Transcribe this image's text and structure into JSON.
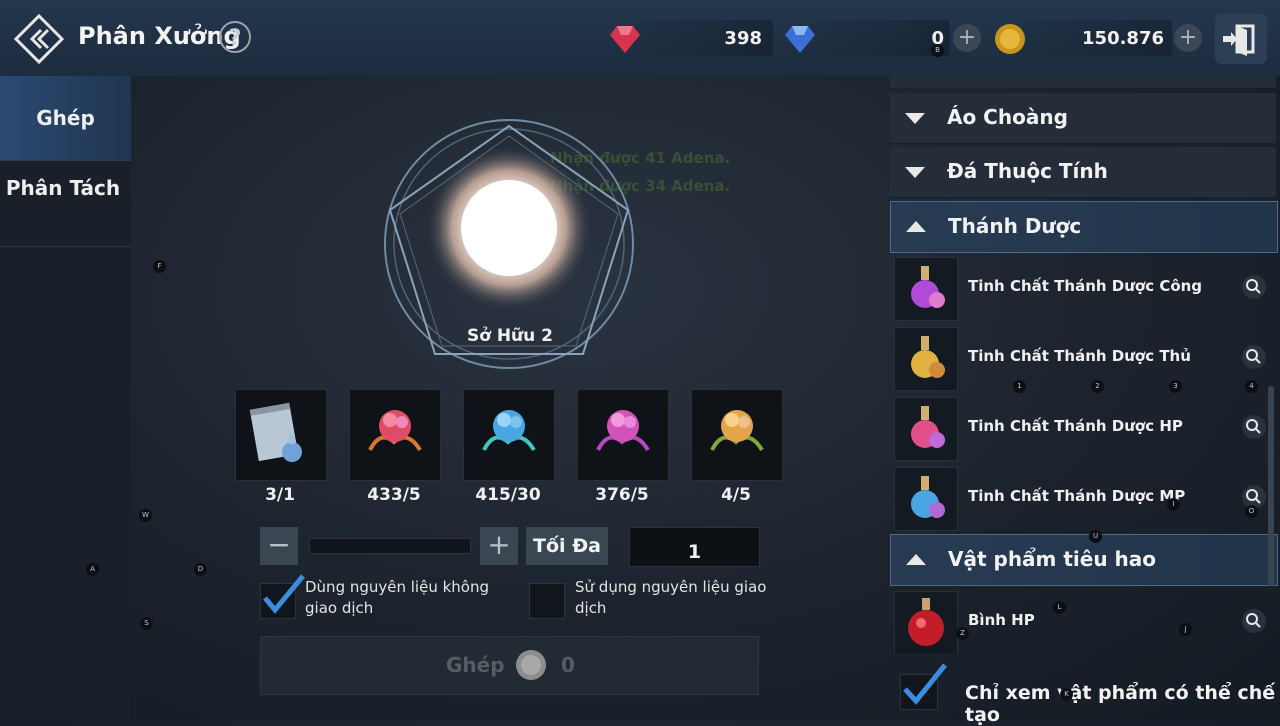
{
  "header": {
    "title": "Phân Xưởng",
    "help_label": "?",
    "currencies": [
      {
        "icon": "red-gem-icon",
        "value": "398",
        "color": "#e23b5a"
      },
      {
        "icon": "blue-gem-icon",
        "value": "0",
        "color": "#3f7fe0"
      },
      {
        "icon": "gold-coin-icon",
        "value": "150.876",
        "color": "#d9a92a"
      }
    ],
    "plus_label": "+"
  },
  "sidebar": {
    "tabs": [
      {
        "label": "Ghép",
        "active": true
      },
      {
        "label": "Phân Tách",
        "active": false
      }
    ]
  },
  "craft": {
    "owned_label": "Sở Hữu  2",
    "faded_lines": [
      "Nhận được 41 Adena.",
      "Nhận được 34 Adena."
    ],
    "materials": [
      {
        "icon": "scroll-potion-icon",
        "count": "3/1"
      },
      {
        "icon": "red-flower-icon",
        "count": "433/5"
      },
      {
        "icon": "blue-flower-icon",
        "count": "415/30"
      },
      {
        "icon": "purple-flower-icon",
        "count": "376/5"
      },
      {
        "icon": "gold-flower-icon",
        "count": "4/5"
      }
    ],
    "minus_label": "−",
    "plus_label": "+",
    "max_label": "Tối Đa",
    "quantity": "1",
    "progress": 0,
    "chk_nontrade_label": "Dùng nguyên liệu không giao dịch",
    "chk_nontrade_checked": true,
    "chk_trade_label": "Sử dụng nguyên liệu giao dịch",
    "chk_trade_checked": false,
    "ghep_label": "Ghép",
    "ghep_cost": "0"
  },
  "recipe_list": {
    "categories": [
      {
        "label": "Áo Choàng",
        "expanded": false
      },
      {
        "label": "Đá Thuộc Tính",
        "expanded": false
      },
      {
        "label": "Thánh Dược",
        "expanded": true
      },
      {
        "label": "Vật phẩm tiêu hao",
        "expanded": true
      }
    ],
    "thanh_duoc_items": [
      {
        "name": "Tinh Chất Thánh Dược Công",
        "icon": "purple-elixir-icon"
      },
      {
        "name": "Tinh Chất Thánh Dược Thủ",
        "icon": "gold-elixir-icon"
      },
      {
        "name": "Tinh Chất Thánh Dược HP",
        "icon": "red-elixir-icon"
      },
      {
        "name": "Tinh Chất Thánh Dược MP",
        "icon": "blue-elixir-icon"
      }
    ],
    "consumable_items": [
      {
        "name": "Bình HP",
        "icon": "red-potion-icon"
      }
    ],
    "only_craftable_label": "Chỉ xem vật phẩm có thể chế tạo",
    "only_craftable_checked": true
  },
  "key_hints": [
    "B",
    "F",
    "W",
    "A",
    "D",
    "S",
    "1",
    "2",
    "3",
    "4",
    "I",
    "O",
    "U",
    "L",
    "Z",
    "J",
    "K"
  ]
}
